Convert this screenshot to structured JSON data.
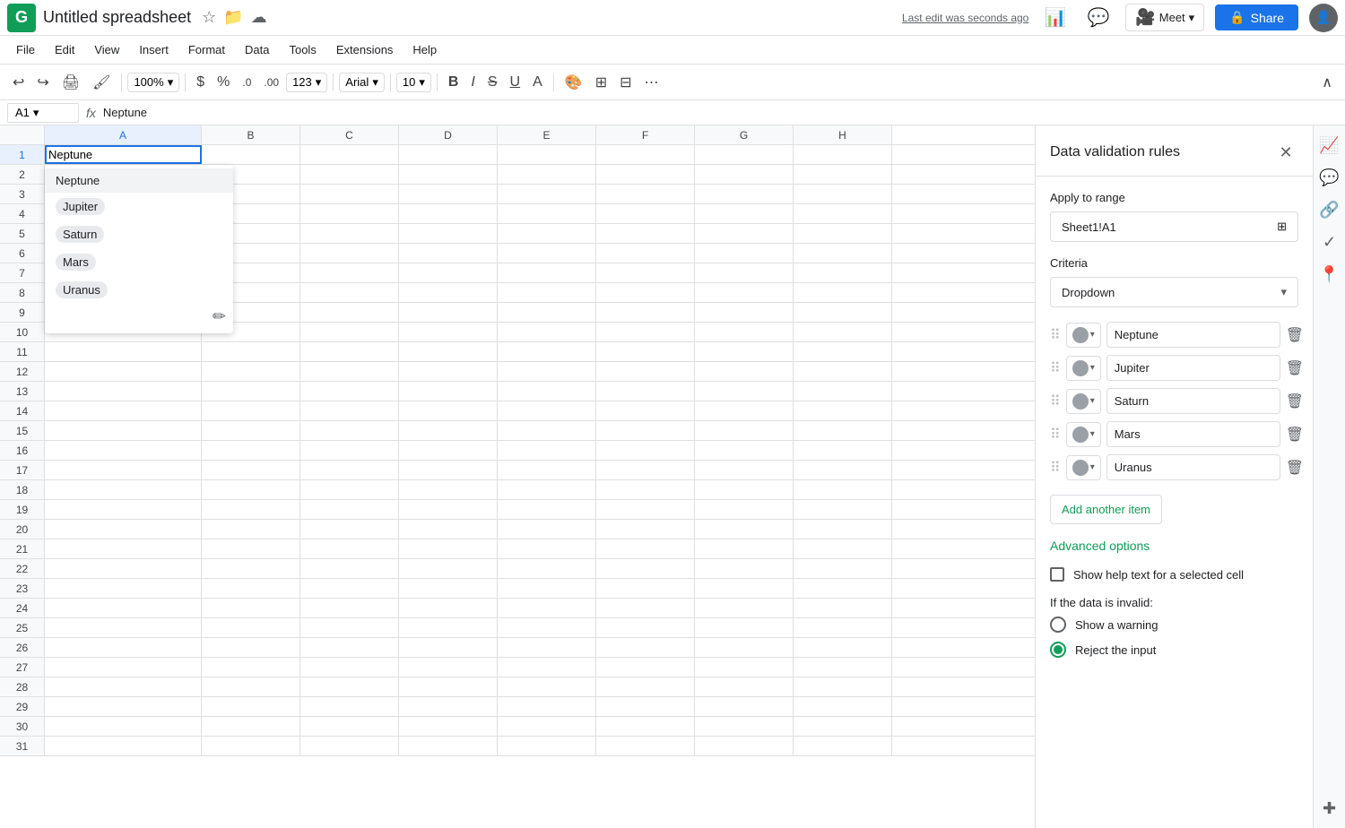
{
  "app": {
    "logo": "G",
    "title": "Untitled spreadsheet",
    "last_edit": "Last edit was seconds ago"
  },
  "toolbar_top": {
    "undo": "↩",
    "redo": "↪",
    "print": "🖨",
    "format_paint": "🖌",
    "zoom": "100%",
    "currency": "$",
    "percent": "%",
    "decimal_dec": ".0",
    "decimal_inc": ".00",
    "number_format": "123",
    "font": "Arial",
    "font_size": "10",
    "bold": "B",
    "italic": "I",
    "strikethrough": "S",
    "underline": "U",
    "more": "⋯"
  },
  "formula_bar": {
    "cell_ref": "A1",
    "fx": "fx",
    "value": "Neptune"
  },
  "columns": [
    "A",
    "B",
    "C",
    "D",
    "E",
    "F",
    "G",
    "H"
  ],
  "rows": [
    1,
    2,
    3,
    4,
    5,
    6,
    7,
    8,
    9,
    10,
    11,
    12,
    13,
    14,
    15,
    16,
    17,
    18,
    19,
    20,
    21,
    22,
    23,
    24,
    25,
    26,
    27,
    28,
    29,
    30,
    31
  ],
  "cell_a1": "Neptune",
  "dropdown": {
    "options": [
      {
        "label": "Neptune",
        "chip": false
      },
      {
        "label": "Jupiter",
        "chip": true
      },
      {
        "label": "Saturn",
        "chip": true
      },
      {
        "label": "Mars",
        "chip": true
      },
      {
        "label": "Uranus",
        "chip": true
      }
    ],
    "edit_icon": "✏"
  },
  "panel": {
    "title": "Data validation rules",
    "close_icon": "✕",
    "apply_label": "Apply to range",
    "range_value": "Sheet1!A1",
    "criteria_label": "Criteria",
    "criteria_value": "Dropdown",
    "criteria_arrow": "▾",
    "items": [
      {
        "value": "Neptune"
      },
      {
        "value": "Jupiter"
      },
      {
        "value": "Saturn"
      },
      {
        "value": "Mars"
      },
      {
        "value": "Uranus"
      }
    ],
    "add_item_label": "Add another item",
    "advanced_label": "Advanced options",
    "help_text_label": "Show help text for a selected cell",
    "invalid_label": "If the data is invalid:",
    "show_warning_label": "Show a warning",
    "reject_label": "Reject the input"
  },
  "right_sidebar": {
    "icons": [
      "📈",
      "💬",
      "🔗",
      "✓",
      "📍",
      "✚"
    ]
  }
}
